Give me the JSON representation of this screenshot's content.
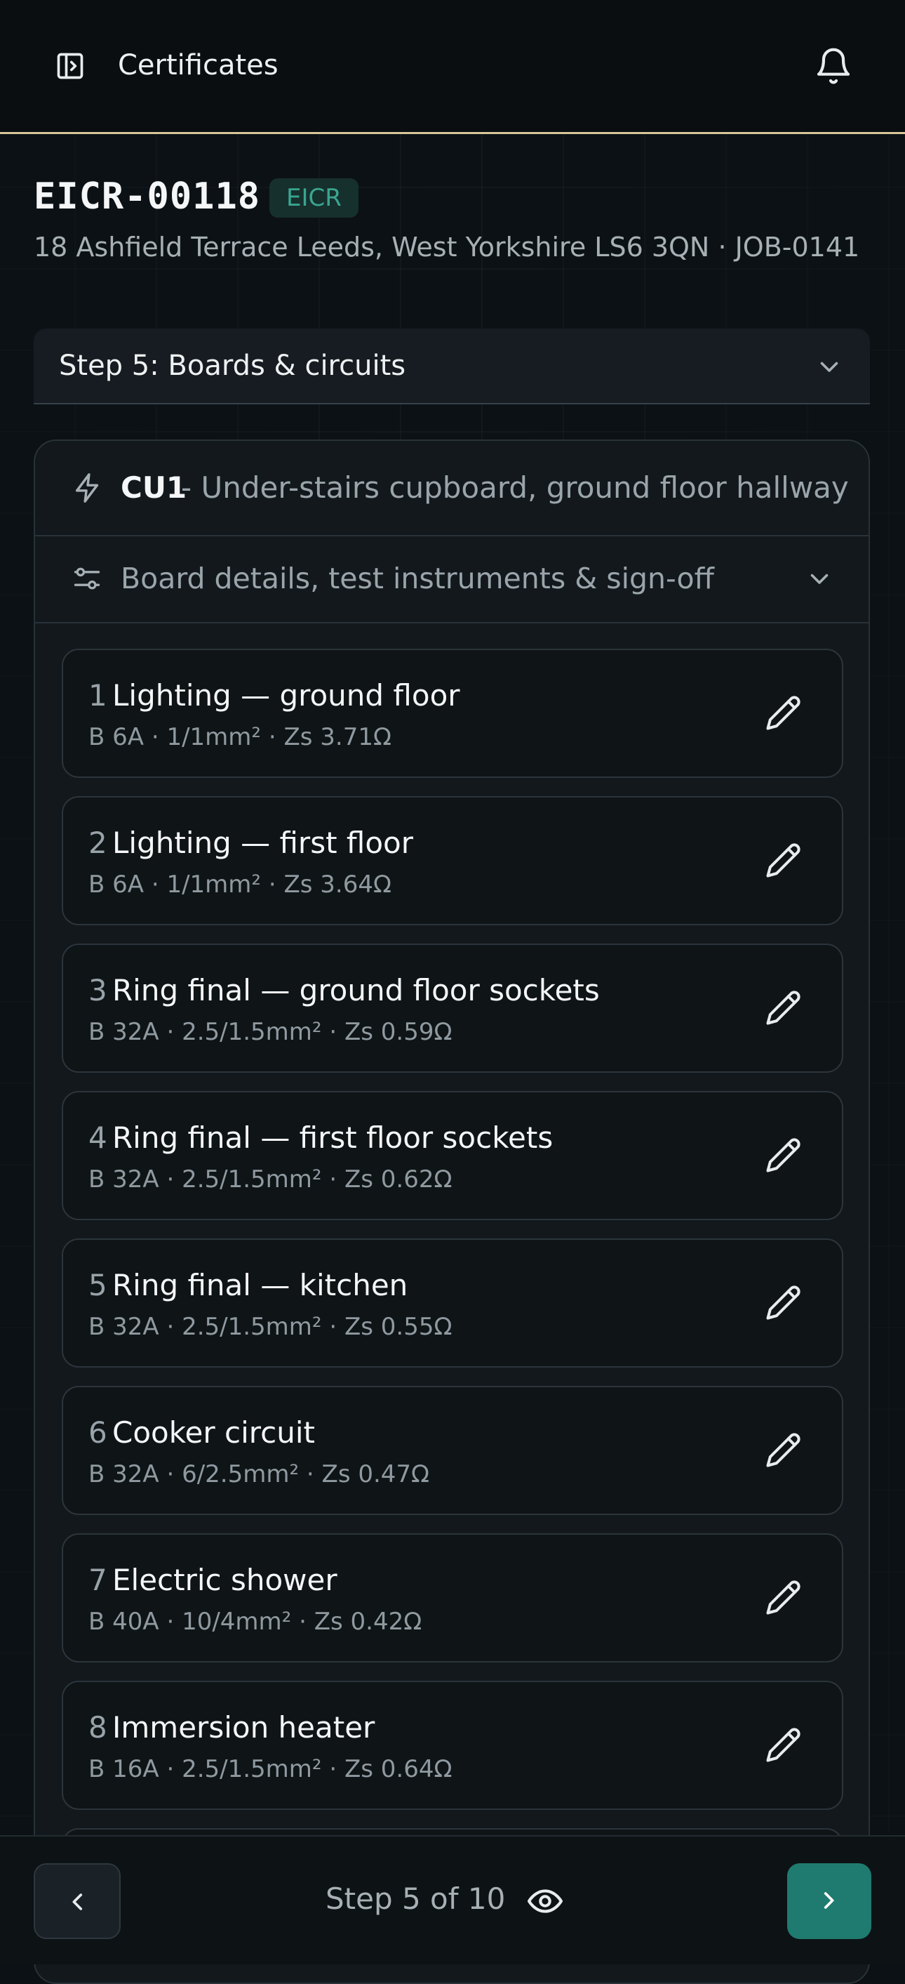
{
  "header": {
    "title": "Certificates"
  },
  "certificate": {
    "id": "EICR-00118",
    "badge": "EICR",
    "address": "18 Ashfield Terrace Leeds, West Yorkshire LS6 3QN · JOB-0141"
  },
  "step_selector": {
    "label": "Step 5: Boards & circuits"
  },
  "board": {
    "name": "CU1",
    "location": "- Under-stairs cupboard, ground floor hallway",
    "details_label": "Board details, test instruments & sign-off"
  },
  "circuits": [
    {
      "num": "1",
      "name": "Lighting — ground floor",
      "spec": "B 6A · 1/1mm² · Zs 3.71Ω"
    },
    {
      "num": "2",
      "name": "Lighting — first floor",
      "spec": "B 6A · 1/1mm² · Zs 3.64Ω"
    },
    {
      "num": "3",
      "name": "Ring final — ground floor sockets",
      "spec": "B 32A · 2.5/1.5mm² · Zs 0.59Ω"
    },
    {
      "num": "4",
      "name": "Ring final — first floor sockets",
      "spec": "B 32A · 2.5/1.5mm² · Zs 0.62Ω"
    },
    {
      "num": "5",
      "name": "Ring final — kitchen",
      "spec": "B 32A · 2.5/1.5mm² · Zs 0.55Ω"
    },
    {
      "num": "6",
      "name": "Cooker circuit",
      "spec": "B 32A · 6/2.5mm² · Zs 0.47Ω"
    },
    {
      "num": "7",
      "name": "Electric shower",
      "spec": "B 40A · 10/4mm² · Zs 0.42Ω"
    },
    {
      "num": "8",
      "name": "Immersion heater",
      "spec": "B 16A · 2.5/1.5mm² · Zs 0.64Ω"
    }
  ],
  "footer": {
    "step_text": "Step 5 of 10"
  },
  "colors": {
    "accent": "#1f7b6f",
    "badge_text": "#3aa591",
    "header_border": "#d8c59a"
  },
  "icons": [
    "sidebar-toggle-icon",
    "bell-icon",
    "chevron-down-icon",
    "bolt-icon",
    "sliders-icon",
    "pencil-icon",
    "chevron-left-icon",
    "eye-icon",
    "chevron-right-icon"
  ]
}
